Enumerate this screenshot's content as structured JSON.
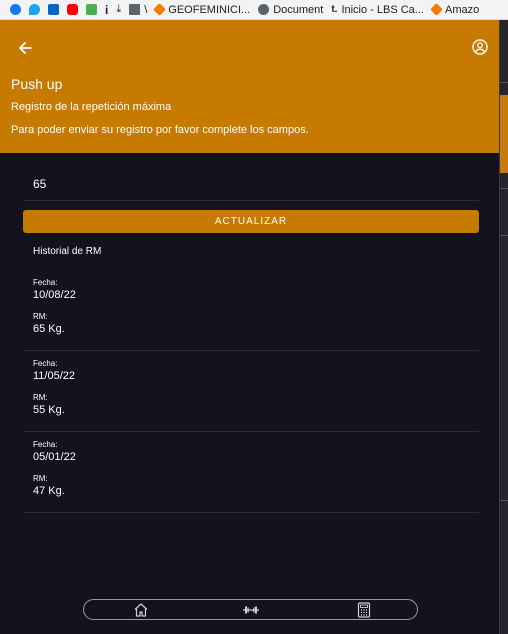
{
  "bookmarks": [
    {
      "icon": "facebook-icon",
      "color": "#1877f2",
      "label": ""
    },
    {
      "icon": "twitter-icon",
      "color": "#1da1f2",
      "label": ""
    },
    {
      "icon": "outlook-icon",
      "color": "#0a64c4",
      "label": ""
    },
    {
      "icon": "youtube-icon",
      "color": "#ff0000",
      "label": ""
    },
    {
      "icon": "cb-icon",
      "color": "#4caf50",
      "label": ""
    },
    {
      "icon": "info-icon",
      "color": "#202124",
      "label": ""
    },
    {
      "icon": "download-icon",
      "color": "#202124",
      "label": ""
    },
    {
      "icon": "folder-icon",
      "color": "#5f6368",
      "label": ""
    },
    {
      "icon": "geofeminicidio-icon",
      "color": "#f57c00",
      "label": "GEOFEMINICI..."
    },
    {
      "icon": "globe-icon",
      "color": "#5f6368",
      "label": "Document"
    },
    {
      "icon": "lbs-icon",
      "color": "#333333",
      "label": "Inicio - LBS Ca..."
    },
    {
      "icon": "amazon-icon",
      "color": "#f57c00",
      "label": "Amazo"
    }
  ],
  "header": {
    "title": "Push up",
    "subtitle": "Registro de la repetición máxima",
    "instructions": "Para poder enviar su registro por favor complete los campos."
  },
  "form": {
    "rm_value": "65",
    "update_label": "ACTUALIZAR"
  },
  "history": {
    "title": "Historial de RM",
    "date_label": "Fecha:",
    "rm_label": "RM:",
    "entries": [
      {
        "date": "10/08/22",
        "rm": "65 Kg."
      },
      {
        "date": "11/05/22",
        "rm": "55 Kg."
      },
      {
        "date": "05/01/22",
        "rm": "47 Kg."
      }
    ]
  },
  "colors": {
    "accent": "#c77a00",
    "background": "#13121f"
  },
  "nav": {
    "icons": [
      "home-icon",
      "dumbbell-icon",
      "calculator-icon"
    ]
  }
}
